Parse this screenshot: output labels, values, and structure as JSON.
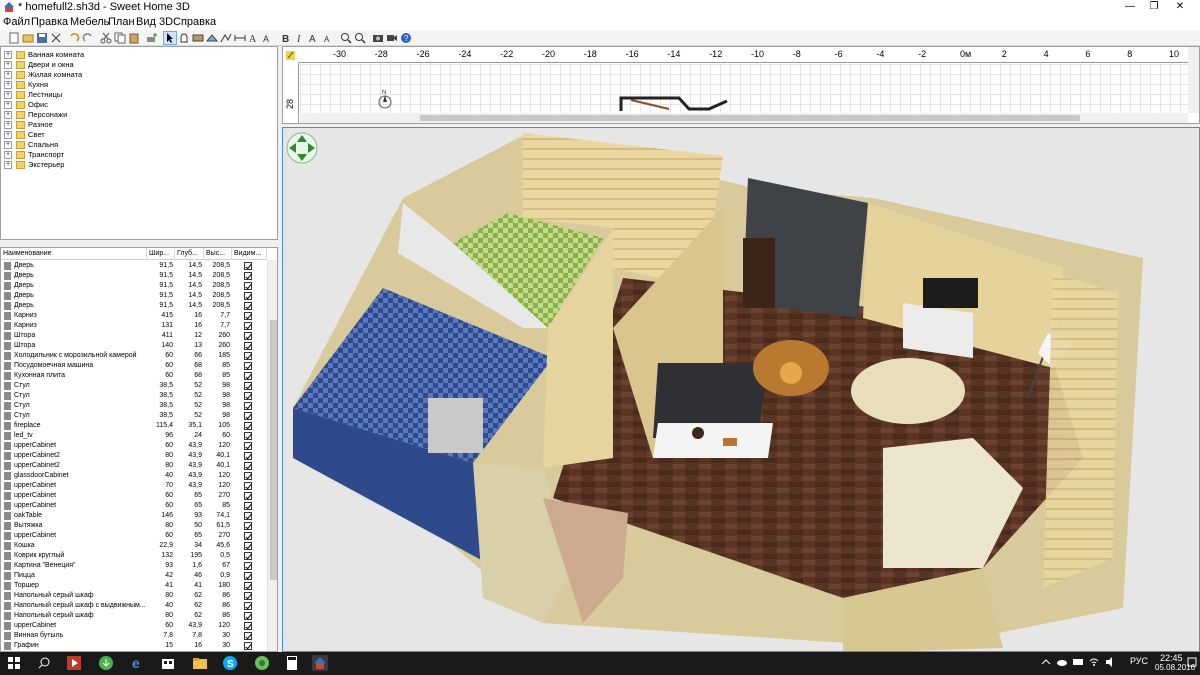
{
  "window": {
    "title": "* homefull2.sh3d - Sweet Home 3D",
    "minimize": "—",
    "restore": "❐",
    "close": "✕"
  },
  "menu": [
    "Файл",
    "Правка",
    "Мебель",
    "План",
    "Вид 3D",
    "Справка"
  ],
  "catalog": [
    "Ванная комната",
    "Двери и окна",
    "Жилая комната",
    "Кухня",
    "Лестницы",
    "Офис",
    "Персонажи",
    "Разное",
    "Свет",
    "Спальня",
    "Транспорт",
    "Экстерьер"
  ],
  "furniture_table": {
    "headers": {
      "name": "Наименование",
      "width": "Шир...",
      "depth": "Глуб...",
      "height": "Выс...",
      "visible": "Видим..."
    },
    "rows": [
      {
        "name": "Дверь",
        "w": "91,5",
        "d": "14,5",
        "h": "208,5"
      },
      {
        "name": "Дверь",
        "w": "91,5",
        "d": "14,5",
        "h": "208,5"
      },
      {
        "name": "Дверь",
        "w": "91,5",
        "d": "14,5",
        "h": "208,5"
      },
      {
        "name": "Дверь",
        "w": "91,5",
        "d": "14,5",
        "h": "208,5"
      },
      {
        "name": "Дверь",
        "w": "91,5",
        "d": "14,5",
        "h": "208,5"
      },
      {
        "name": "Карниз",
        "w": "415",
        "d": "16",
        "h": "7,7"
      },
      {
        "name": "Карниз",
        "w": "131",
        "d": "16",
        "h": "7,7"
      },
      {
        "name": "Штора",
        "w": "411",
        "d": "12",
        "h": "260"
      },
      {
        "name": "Штора",
        "w": "140",
        "d": "13",
        "h": "260"
      },
      {
        "name": "Холодильник с морозильной камерой",
        "w": "60",
        "d": "66",
        "h": "185"
      },
      {
        "name": "Посудомоечная машина",
        "w": "60",
        "d": "68",
        "h": "85"
      },
      {
        "name": "Кухонная плита",
        "w": "60",
        "d": "68",
        "h": "85"
      },
      {
        "name": "Стул",
        "w": "38,5",
        "d": "52",
        "h": "98"
      },
      {
        "name": "Стул",
        "w": "38,5",
        "d": "52",
        "h": "98"
      },
      {
        "name": "Стул",
        "w": "38,5",
        "d": "52",
        "h": "98"
      },
      {
        "name": "Стул",
        "w": "38,5",
        "d": "52",
        "h": "98"
      },
      {
        "name": "fireplace",
        "w": "115,4",
        "d": "35,1",
        "h": "105"
      },
      {
        "name": "led_tv",
        "w": "96",
        "d": "24",
        "h": "60"
      },
      {
        "name": "upperCabinet",
        "w": "60",
        "d": "43,9",
        "h": "120"
      },
      {
        "name": "upperCabinet2",
        "w": "80",
        "d": "43,9",
        "h": "40,1"
      },
      {
        "name": "upperCabinet2",
        "w": "80",
        "d": "43,9",
        "h": "40,1"
      },
      {
        "name": "glassdoorCabinet",
        "w": "40",
        "d": "43,9",
        "h": "120"
      },
      {
        "name": "upperCabinet",
        "w": "70",
        "d": "43,9",
        "h": "120"
      },
      {
        "name": "upperCabinet",
        "w": "60",
        "d": "65",
        "h": "270"
      },
      {
        "name": "upperCabinet",
        "w": "60",
        "d": "65",
        "h": "85"
      },
      {
        "name": "oakTable",
        "w": "146",
        "d": "93",
        "h": "74,1"
      },
      {
        "name": "Вытяжка",
        "w": "80",
        "d": "50",
        "h": "61,5"
      },
      {
        "name": "upperCabinet",
        "w": "60",
        "d": "65",
        "h": "270"
      },
      {
        "name": "Кошка",
        "w": "22,9",
        "d": "34",
        "h": "45,6"
      },
      {
        "name": "Коврик круглый",
        "w": "132",
        "d": "195",
        "h": "0,5"
      },
      {
        "name": "Картина \"Венеция\"",
        "w": "93",
        "d": "1,6",
        "h": "67"
      },
      {
        "name": "Пицца",
        "w": "42",
        "d": "46",
        "h": "0,9"
      },
      {
        "name": "Торшер",
        "w": "41",
        "d": "41",
        "h": "180"
      },
      {
        "name": "Напольный серый шкаф",
        "w": "80",
        "d": "62",
        "h": "86"
      },
      {
        "name": "Напольный серый шкаф с выдвижным...",
        "w": "40",
        "d": "62",
        "h": "86"
      },
      {
        "name": "Напольный серый шкаф",
        "w": "80",
        "d": "62",
        "h": "86"
      },
      {
        "name": "upperCabinet",
        "w": "60",
        "d": "43,9",
        "h": "120"
      },
      {
        "name": "Винная бутыль",
        "w": "7,8",
        "d": "7,8",
        "h": "30"
      },
      {
        "name": "Графин",
        "w": "15",
        "d": "16",
        "h": "30"
      }
    ]
  },
  "plan": {
    "ruler_ticks": [
      "-30",
      "-28",
      "-26",
      "-24",
      "-22",
      "-20",
      "-18",
      "-16",
      "-14",
      "-12",
      "-10",
      "-8",
      "-6",
      "-4",
      "-2",
      "0м",
      "2",
      "4",
      "6",
      "8",
      "10"
    ],
    "left_ruler_label": "28"
  },
  "taskbar": {
    "language": "РУС",
    "time": "22:45",
    "date": "05.08.2016"
  },
  "colors": {
    "accent_border": "#4a90d9",
    "taskbar": "#1a1a1a",
    "wall": "#d8ca9a",
    "floor": "#5b3524"
  }
}
